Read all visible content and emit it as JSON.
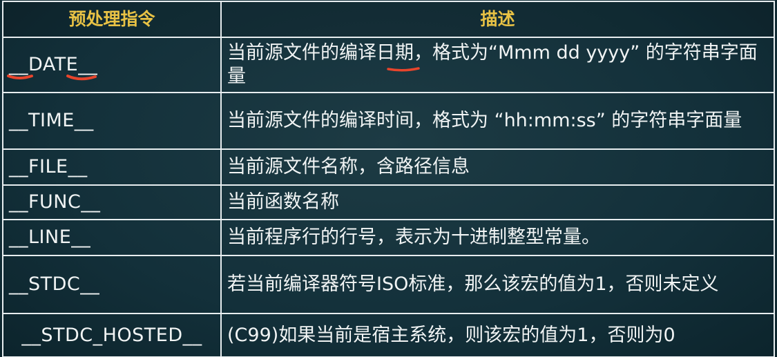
{
  "header": {
    "col_directive": "预处理指令",
    "col_description": "描述"
  },
  "rows": [
    {
      "name": "__DATE__",
      "desc": "当前源文件的编译日期，格式为“Mmm dd yyyy” 的字符串字面量"
    },
    {
      "name": "__TIME__",
      "desc": "当前源文件的编译时间，格式为 “hh:mm:ss” 的字符串字面量"
    },
    {
      "name": "__FILE__",
      "desc": "当前源文件名称，含路径信息"
    },
    {
      "name": "__FUNC__",
      "desc": "当前函数名称"
    },
    {
      "name": "__LINE__",
      "desc": "当前程序行的行号，表示为十进制整型常量。"
    },
    {
      "name": "__STDC__",
      "desc": "若当前编译器符号ISO标准，那么该宏的值为1，否则未定义"
    },
    {
      "name": "__STDC_HOSTED__",
      "desc": "(C99)如果当前是宿主系统，则该宏的值为1，否则为0"
    }
  ],
  "annotation_color": "#e8452c"
}
